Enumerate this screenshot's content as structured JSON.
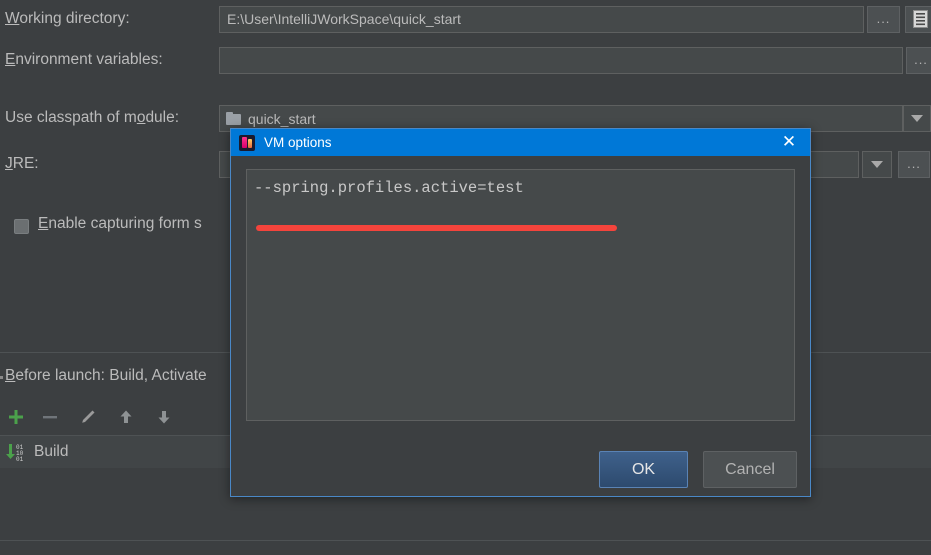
{
  "panel": {
    "rows": [
      {
        "label_prefix": "",
        "label_accel": "W",
        "label_rest": "orking directory:",
        "label_full": "Working directory:",
        "value": "E:\\User\\IntelliJWorkSpace\\quick_start",
        "browse_label": "...",
        "macro_icon": "macro-list-icon"
      },
      {
        "label_accel": "E",
        "label_rest": "nvironment variables:",
        "label_full": "Environment variables:",
        "value": "",
        "browse_label": "..."
      },
      {
        "label_prefix": "Use classpath of m",
        "label_accel": "o",
        "label_rest": "dule:",
        "label_full": "Use classpath of module:",
        "value": "quick_start",
        "folder_icon": "folder-icon",
        "dropdown_icon": "chevron-down-icon"
      },
      {
        "label_accel": "J",
        "label_rest": "RE:",
        "label_full": "JRE:",
        "value": "",
        "dropdown_icon": "chevron-down-icon",
        "browse_label": "..."
      }
    ],
    "checkbox": {
      "label_accel": "E",
      "label_rest": "nable capturing form s",
      "label_full": "Enable capturing form s",
      "checked": false
    },
    "before_launch": {
      "label_accel": "B",
      "label_rest": "efore launch: Build, Activate",
      "label_full": "Before launch: Build, Activate",
      "toolbar": [
        {
          "name": "add-button",
          "glyph": "+",
          "color": "#4ba14b"
        },
        {
          "name": "remove-button",
          "glyph": "–",
          "color": "#6f7375"
        },
        {
          "name": "edit-button",
          "glyph": "✎",
          "color": "#9a9a9a"
        },
        {
          "name": "move-up-button",
          "glyph": "↑",
          "color": "#8e9294"
        },
        {
          "name": "move-down-button",
          "glyph": "↓",
          "color": "#8e9294"
        }
      ],
      "items": [
        {
          "label": "Build",
          "icon": "build-icon"
        }
      ]
    }
  },
  "dialog": {
    "title": "VM options",
    "app_icon": "intellij-idea-icon",
    "close_label": "✕",
    "text_value": "--spring.profiles.active=test",
    "annotation_color": "#f4443c",
    "buttons": {
      "ok": "OK",
      "cancel": "Cancel"
    }
  },
  "colors": {
    "window_bg": "#3c3f41",
    "field_bg": "#45494a",
    "titlebar_blue": "#0078d7",
    "dialog_border": "#4a88c7",
    "ok_blue": "#2d4a6e",
    "annotation_red": "#f4443c",
    "add_green": "#4ba14b"
  }
}
